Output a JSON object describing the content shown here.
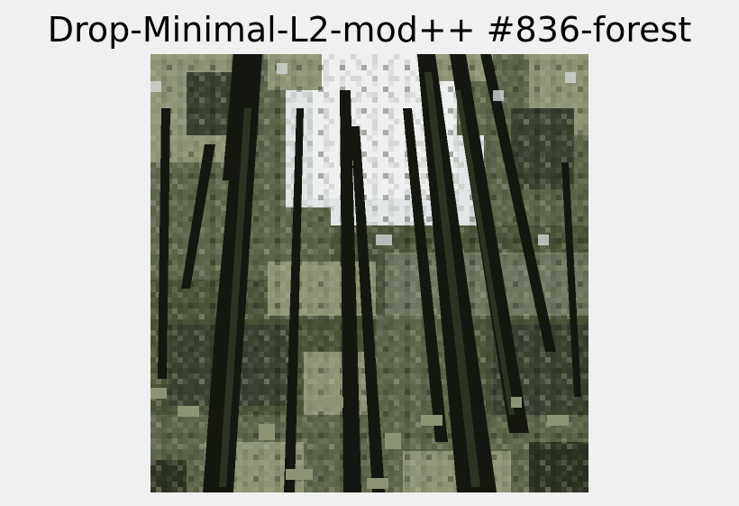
{
  "title": "Drop-Minimal-L2-mod++ #836-forest",
  "image": {
    "subject": "forest",
    "style": "pixelated low-resolution photo",
    "palette": {
      "figure_background": "#f0f0f0",
      "sky": "#e2e5e6",
      "sky_light": "#d3d7d5",
      "foliage_dark": "#2d3323",
      "foliage_mid": "#5c6449",
      "foliage_light": "#8d9474",
      "trunk": "#141710"
    }
  }
}
